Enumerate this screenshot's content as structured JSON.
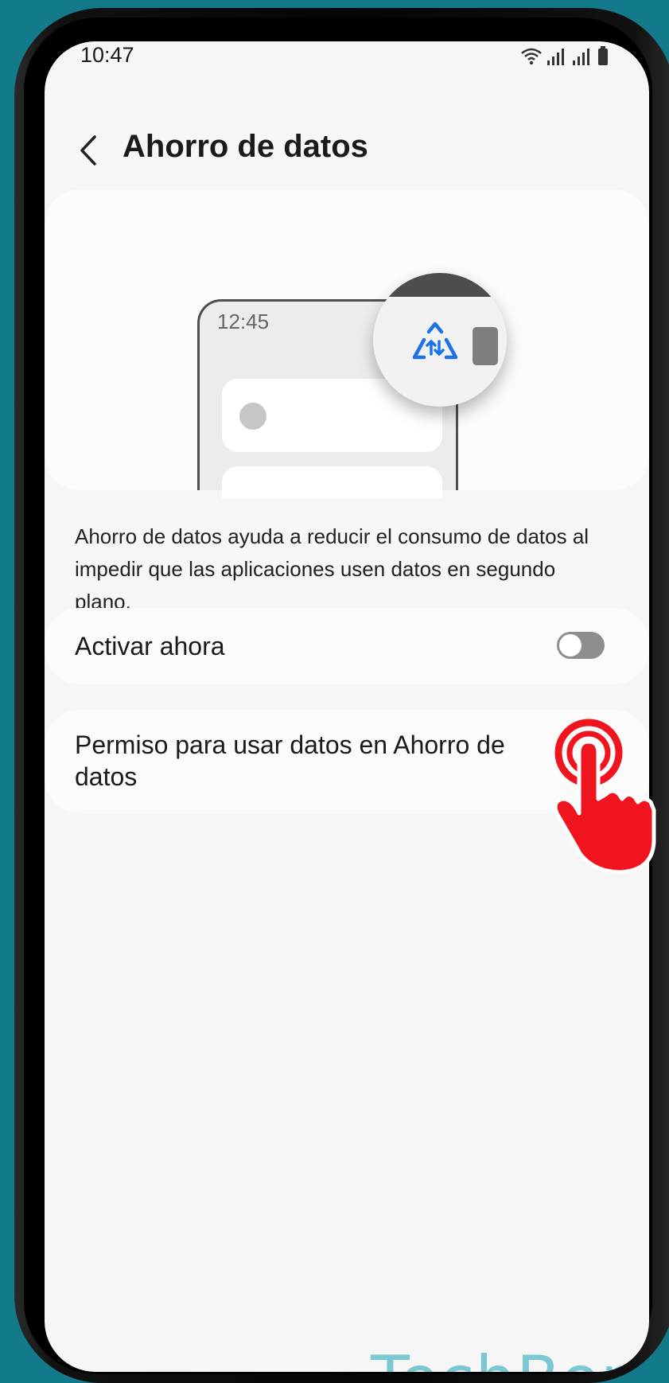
{
  "status_bar": {
    "time": "10:47",
    "icons": [
      "wifi-icon",
      "signal-icon",
      "signal-icon",
      "battery-icon"
    ]
  },
  "header": {
    "title": "Ahorro de datos",
    "back_icon": "chevron-left-icon"
  },
  "illustration": {
    "time": "12:45",
    "icon": "data-saver-icon",
    "accent_color": "#1a73e8"
  },
  "description": "Ahorro de datos ayuda a reducir el consumo de datos al impedir que las aplicaciones usen datos en segundo plano.",
  "settings": {
    "activate": {
      "label": "Activar ahora",
      "toggle_on": false
    },
    "permission": {
      "label": "Permiso para usar datos en Ahorro de datos"
    }
  },
  "overlay": {
    "tap_icon": "tap-hand-icon",
    "tap_color": "#f0141e"
  },
  "watermark": "TechBone"
}
